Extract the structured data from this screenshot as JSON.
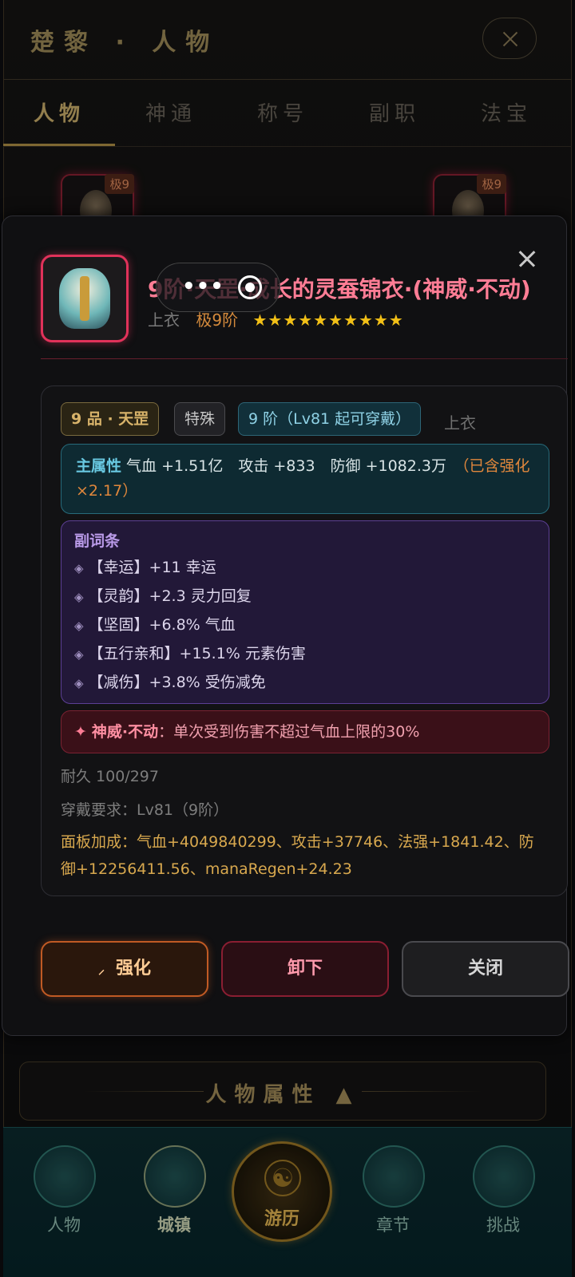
{
  "header": {
    "title": "楚黎 · 人物"
  },
  "tabs": [
    {
      "label": "人物",
      "active": true
    },
    {
      "label": "神通"
    },
    {
      "label": "称号"
    },
    {
      "label": "副职"
    },
    {
      "label": "法宝"
    }
  ],
  "background_slots": [
    {
      "badge": "极9"
    },
    {
      "badge": "极9"
    }
  ],
  "attribute_bar": {
    "label": "人物属性 ▲"
  },
  "nav": [
    {
      "label": "人物",
      "icon": "character-icon"
    },
    {
      "label": "城镇",
      "icon": "town-icon"
    },
    {
      "label": "游历",
      "icon": "yinyang-icon",
      "active": true
    },
    {
      "label": "章节",
      "icon": "scroll-icon"
    },
    {
      "label": "挑战",
      "icon": "sword-icon"
    }
  ],
  "modal": {
    "item_name": "9阶·天罡·成长的灵蚕锦衣·(神威·不动)",
    "slot": "上衣",
    "tier": "极9阶",
    "stars": "★★★★★★★★★★",
    "chips": {
      "grade": "9 品 · 天罡",
      "special": "特殊",
      "requirement": "9 阶（Lv81 起可穿戴）",
      "slot": "上衣"
    },
    "main_attr": {
      "label": "主属性",
      "value": " 气血 +1.51亿　攻击 +833　防御 +1082.3万　",
      "note": "（已含强化 ×2.17）"
    },
    "sub_attrs": {
      "title": "副词条",
      "items": [
        "【幸运】+11 幸运",
        "【灵韵】+2.3 灵力回复",
        "【坚固】+6.8% 气血",
        "【五行亲和】+15.1% 元素伤害",
        "【减伤】+3.8% 受伤减免"
      ]
    },
    "skill": {
      "name": "神威·不动",
      "desc": "：单次受到伤害不超过气血上限的30%"
    },
    "durability": "耐久 100/297",
    "wear_req": "穿戴要求：Lv81（9阶）",
    "panel_bonus": "面板加成：气血+4049840299、攻击+37746、法强+1841.42、防御+12256411.56、manaRegen+24.23",
    "buttons": {
      "strengthen": "强化",
      "unequip": "卸下",
      "close": "关闭"
    }
  },
  "colors": {
    "accent_gold": "#b39a5e",
    "item_red": "#e0325a",
    "main_attr_cyan": "#69c9e2",
    "sub_attr_purple": "#b99ae8"
  }
}
